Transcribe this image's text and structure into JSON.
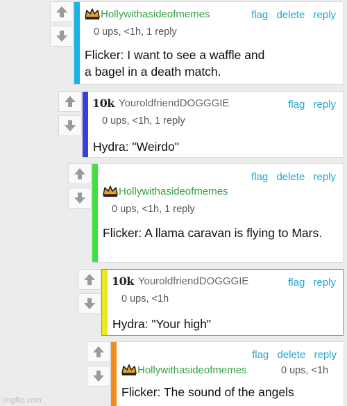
{
  "comments": [
    {
      "author": "Hollywithasideofmemes",
      "meta": "0 ups, <1h, 1 reply",
      "text": "Flicker: I want to see a waffle and a bagel in a death match.",
      "actions": [
        "flag",
        "delete",
        "reply"
      ],
      "bar_color": "#1bb2ea"
    },
    {
      "author": "YouroldfriendDOGGGIE",
      "badge": "10k",
      "meta": "0 ups, <1h, 1 reply",
      "text": "Hydra: \"Weirdo\"",
      "actions": [
        "flag",
        "reply"
      ],
      "bar_color": "#3a3fdb"
    },
    {
      "author": "Hollywithasideofmemes",
      "meta": "0 ups, <1h, 1 reply",
      "text": "Flicker: A llama caravan is flying to Mars.",
      "actions": [
        "flag",
        "delete",
        "reply"
      ],
      "bar_color": "#3ee23e"
    },
    {
      "author": "YouroldfriendDOGGGIE",
      "badge": "10k",
      "meta": "0 ups, <1h",
      "text": "Hydra: \"Your high\"",
      "actions": [
        "flag",
        "reply"
      ],
      "bar_color": "#e8ea22"
    },
    {
      "author": "Hollywithasideofmemes",
      "meta": "0 ups, <1h",
      "text": "Flicker: The sound of the angels",
      "actions": [
        "flag",
        "delete",
        "reply"
      ],
      "bar_color": "#f08c1e"
    }
  ],
  "watermark": "imgflip.com",
  "colors": {
    "link": "#1fa8cf",
    "author_green": "#3aa04a",
    "crown": "#f0a020"
  },
  "icons": [
    "up-arrow-icon",
    "down-arrow-icon",
    "crown-icon"
  ]
}
